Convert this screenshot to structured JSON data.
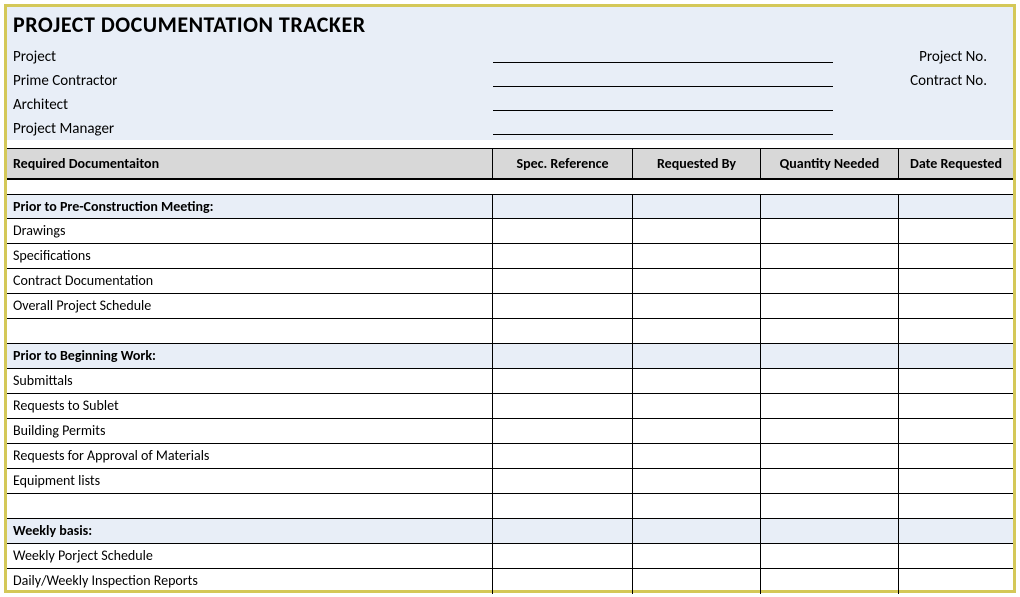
{
  "title": "PROJECT DOCUMENTATION TRACKER",
  "header": {
    "project_label": "Project",
    "prime_contractor_label": "Prime Contractor",
    "architect_label": "Architect",
    "project_manager_label": "Project Manager",
    "project_no_label": "Project No.",
    "contract_no_label": "Contract No."
  },
  "columns": {
    "col1": "Required Documentaiton",
    "col2": "Spec. Reference",
    "col3": "Requested By",
    "col4": "Quantity Needed",
    "col5": "Date Requested"
  },
  "sections": [
    {
      "heading": "Prior to Pre-Construction Meeting:",
      "items": [
        "Drawings",
        "Specifications",
        "Contract Documentation",
        "Overall Project Schedule"
      ]
    },
    {
      "heading": "Prior to Beginning Work:",
      "items": [
        "Submittals",
        "Requests to Sublet",
        "Building Permits",
        "Requests for Approval of Materials",
        "Equipment lists"
      ]
    },
    {
      "heading": "Weekly basis:",
      "items": [
        "Weekly Porject Schedule",
        "Daily/Weekly Inspection Reports"
      ]
    }
  ]
}
